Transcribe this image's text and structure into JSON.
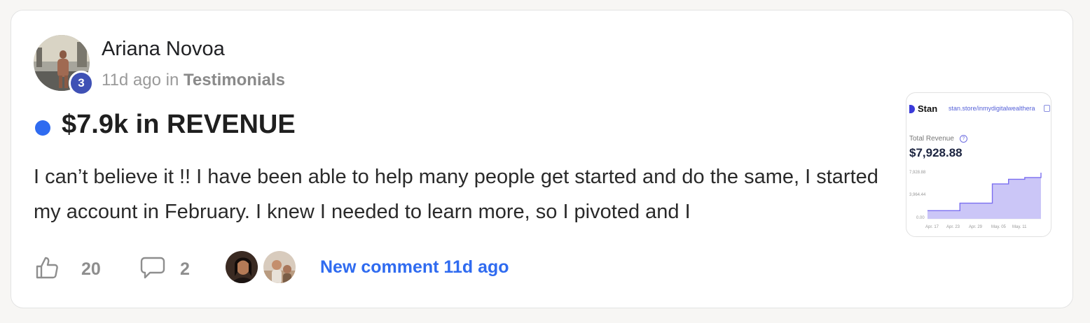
{
  "post": {
    "author": "Ariana Novoa",
    "level": "3",
    "time_ago": "11d ago",
    "in_word": "in",
    "category": "Testimonials",
    "title": "$7.9k in REVENUE",
    "body": "I can’t believe it !! I have been able to help many people get started and do the same, I started my account in February. I knew I needed to learn more, so I pivoted and I",
    "likes": "20",
    "comments": "2",
    "new_comment": "New comment 11d ago"
  },
  "colors": {
    "accent": "#2f6bf0",
    "badge": "#3f51b5"
  },
  "icons": {
    "like": "thumbs-up-icon",
    "comment": "speech-bubble-icon"
  },
  "thumbnail": {
    "brand": "Stan",
    "url": "stan.store/inmydigitalwealthera",
    "label": "Total Revenue",
    "help": "?",
    "total": "$7,928.88",
    "y_ticks": [
      "7,928.88",
      "3,964.44",
      "0.00"
    ],
    "x_ticks": [
      "Apr. 17",
      "Apr. 23",
      "Apr. 29",
      "May. 05",
      "May. 11"
    ]
  },
  "chart_data": {
    "type": "area",
    "x": [
      "Apr. 17",
      "Apr. 23",
      "Apr. 29",
      "May. 05",
      "May. 11"
    ],
    "series": [
      {
        "values": [
          1400,
          1400,
          2700,
          2700,
          6000,
          6800,
          7100,
          7928.88
        ]
      }
    ],
    "ylim": [
      0,
      7928.88
    ]
  }
}
